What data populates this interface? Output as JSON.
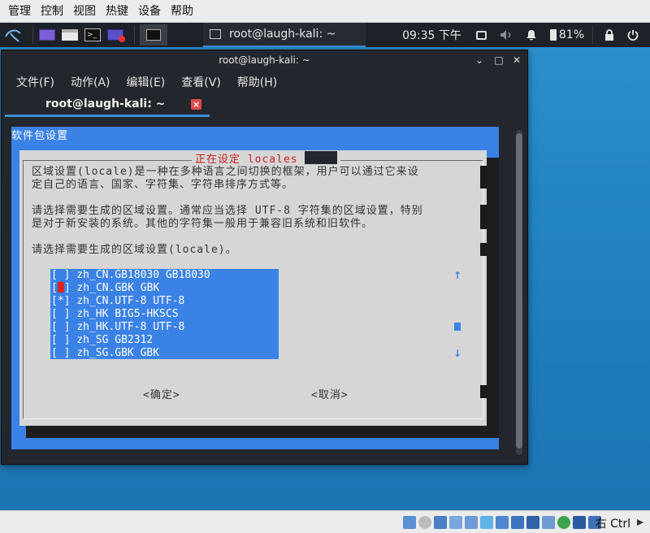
{
  "host": {
    "menu": [
      "管理",
      "控制",
      "视图",
      "热键",
      "设备",
      "帮助"
    ],
    "host_key": "右 Ctrl"
  },
  "panel": {
    "task_label": "root@laugh-kali: ~",
    "clock": "09:35 下午",
    "battery": "81%"
  },
  "terminal": {
    "title": "root@laugh-kali: ~",
    "menu": [
      "文件(F)",
      "动作(A)",
      "编辑(E)",
      "查看(V)",
      "帮助(H)"
    ],
    "tab_label": "root@laugh-kali: ~",
    "tab_close": "×"
  },
  "dialog": {
    "background_title": "软件包设置",
    "title": "正在设定 locales",
    "text_lines": [
      "区域设置(locale)是一种在多种语言之间切换的框架，用户可以通过它来设",
      "定自己的语言、国家、字符集、字符串排序方式等。",
      "请选择需要生成的区域设置。通常应当选择 UTF-8 字符集的区域设置，特别",
      "是对于新安装的系统。其他的字符集一般用于兼容旧系统和旧软件。",
      "请选择需要生成的区域设置(locale)。"
    ],
    "locales": [
      {
        "check": "[ ]",
        "name": "zh_CN.GB18030 GB18030"
      },
      {
        "check": "[ ]",
        "name": "zh_CN.GBK GBK"
      },
      {
        "check": "[*]",
        "name": "zh_CN.UTF-8 UTF-8"
      },
      {
        "check": "[ ]",
        "name": "zh_HK BIG5-HKSCS"
      },
      {
        "check": "[ ]",
        "name": "zh_HK.UTF-8 UTF-8"
      },
      {
        "check": "[ ]",
        "name": "zh_SG GB2312"
      },
      {
        "check": "[ ]",
        "name": "zh_SG.GBK GBK"
      }
    ],
    "ok_button": "<确定>",
    "cancel_button": "<取消>"
  },
  "colors": {
    "dialog_background": "#3b82e6",
    "dialog_body": "#d6d6d6",
    "title_red": "#cc1f1f",
    "panel": "#1d2128",
    "accent": "#3b8ed8"
  }
}
